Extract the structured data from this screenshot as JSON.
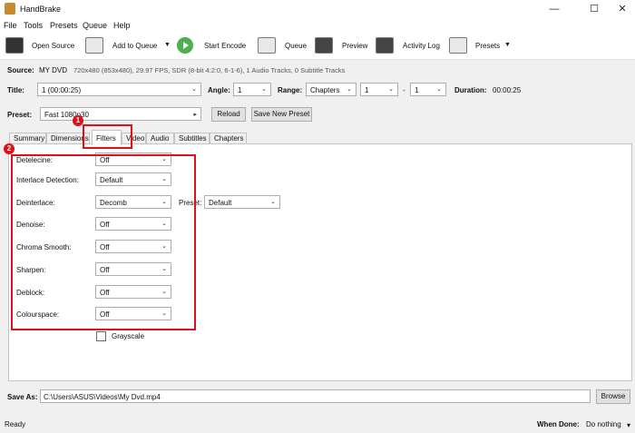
{
  "window": {
    "title": "HandBrake",
    "min": "—",
    "max": "☐",
    "close": "✕"
  },
  "menu": [
    "File",
    "Tools",
    "Presets",
    "Queue",
    "Help"
  ],
  "toolbar": {
    "open_source": "Open Source",
    "add_to_queue": "Add to Queue",
    "start_encode": "Start Encode",
    "queue": "Queue",
    "preview": "Preview",
    "activity_log": "Activity Log",
    "presets": "Presets"
  },
  "source": {
    "label": "Source:",
    "name": "MY DVD",
    "info": "720x480 (853x480), 29.97 FPS, SDR (8-bit 4:2:0, 6-1-6), 1 Audio Tracks, 0 Subtitle Tracks"
  },
  "title_row": {
    "title_label": "Title:",
    "title_value": "1 (00:00:25)",
    "angle_label": "Angle:",
    "angle_value": "1",
    "range_label": "Range:",
    "range_value": "Chapters",
    "range_from": "1",
    "range_dash": "-",
    "range_to": "1",
    "duration_label": "Duration:",
    "duration_value": "00:00:25"
  },
  "preset_row": {
    "label": "Preset:",
    "value": "Fast 1080p30",
    "reload": "Reload",
    "save_new": "Save New Preset"
  },
  "tabs": [
    "Summary",
    "Dimensions",
    "Filters",
    "Video",
    "Audio",
    "Subtitles",
    "Chapters"
  ],
  "filters": {
    "detelecine": {
      "label": "Detelecine:",
      "value": "Off"
    },
    "interlace": {
      "label": "Interlace Detection:",
      "value": "Default"
    },
    "deinterlace": {
      "label": "Deinterlace:",
      "value": "Decomb",
      "preset_label": "Preset:",
      "preset_value": "Default"
    },
    "denoise": {
      "label": "Denoise:",
      "value": "Off"
    },
    "chroma": {
      "label": "Chroma Smooth:",
      "value": "Off"
    },
    "sharpen": {
      "label": "Sharpen:",
      "value": "Off"
    },
    "deblock": {
      "label": "Deblock:",
      "value": "Off"
    },
    "colourspace": {
      "label": "Colourspace:",
      "value": "Off"
    },
    "grayscale": "Grayscale"
  },
  "annotations": {
    "badge1": "1",
    "badge2": "2",
    "accent": "#e0101a"
  },
  "save": {
    "label": "Save As:",
    "path": "C:\\Users\\ASUS\\Videos\\My Dvd.mp4",
    "browse": "Browse"
  },
  "status": {
    "text": "Ready",
    "when_done_label": "When Done:",
    "when_done_value": "Do nothing"
  }
}
